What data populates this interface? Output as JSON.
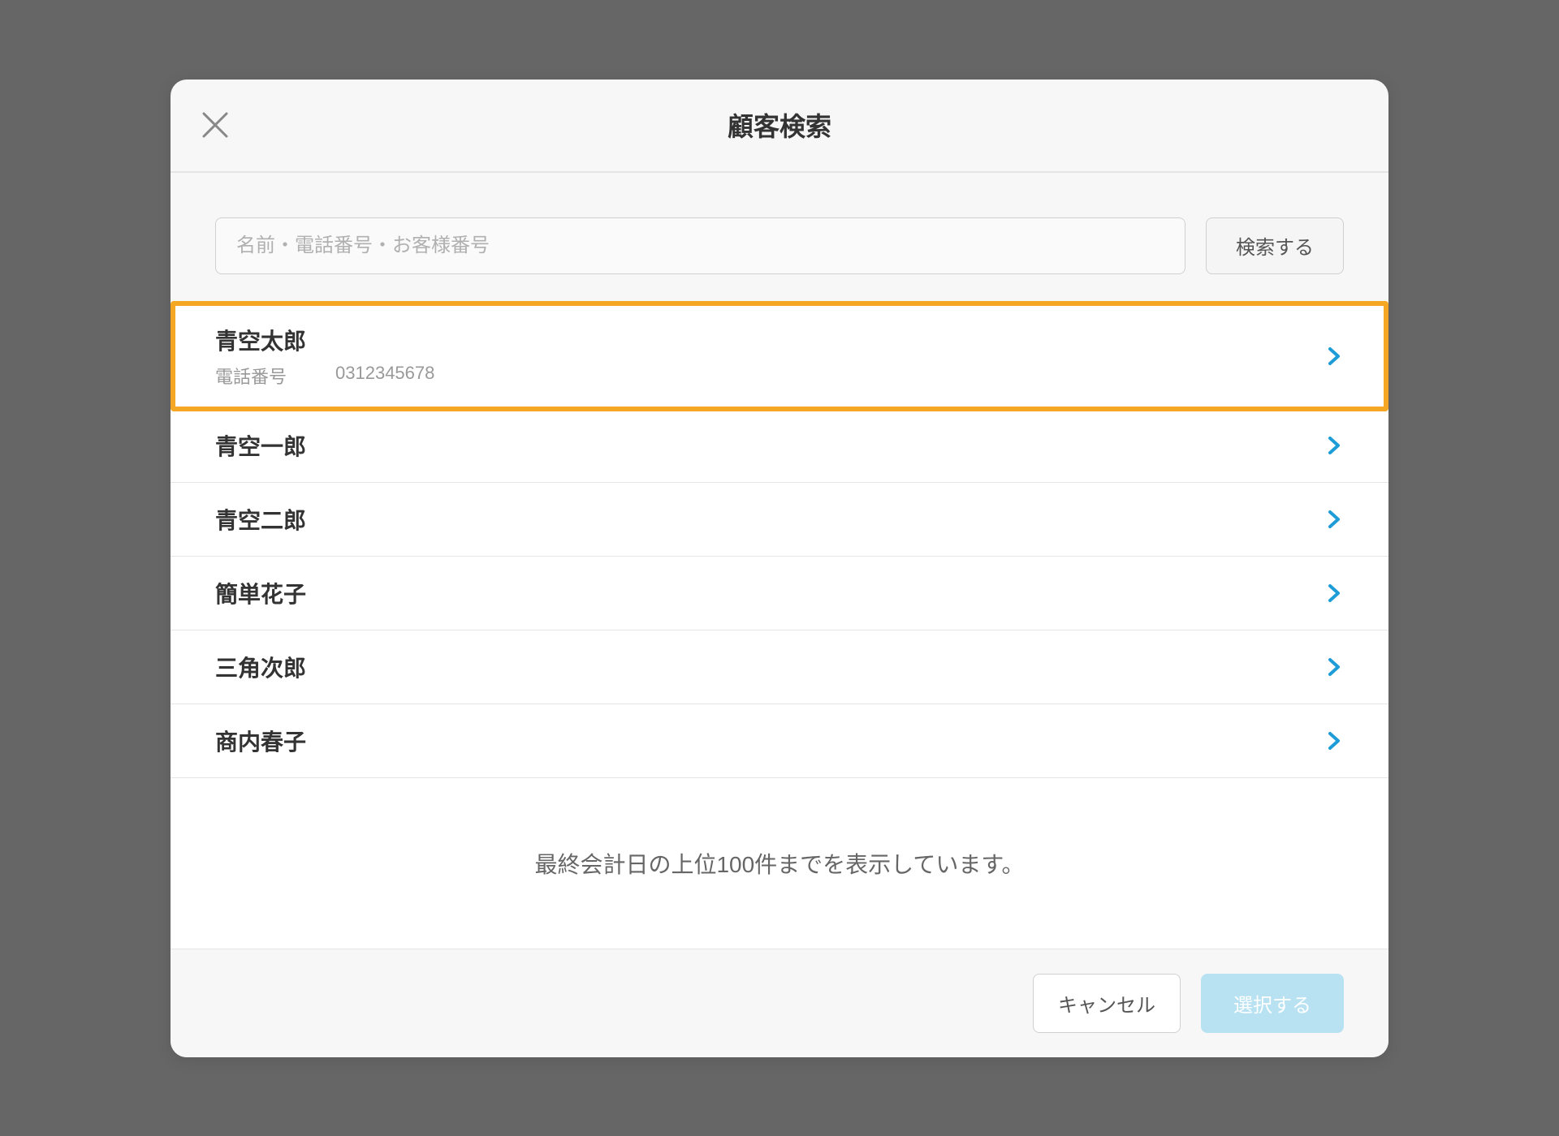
{
  "modal": {
    "title": "顧客検索"
  },
  "search": {
    "placeholder": "名前・電話番号・お客様番号",
    "button_label": "検索する"
  },
  "results": [
    {
      "name": "青空太郎",
      "phone_label": "電話番号",
      "phone_value": "0312345678",
      "highlighted": true
    },
    {
      "name": "青空一郎",
      "highlighted": false
    },
    {
      "name": "青空二郎",
      "highlighted": false
    },
    {
      "name": "簡単花子",
      "highlighted": false
    },
    {
      "name": "三角次郎",
      "highlighted": false
    },
    {
      "name": "商内春子",
      "highlighted": false
    }
  ],
  "info_message": "最終会計日の上位100件までを表示しています。",
  "footer": {
    "cancel_label": "キャンセル",
    "select_label": "選択する"
  }
}
